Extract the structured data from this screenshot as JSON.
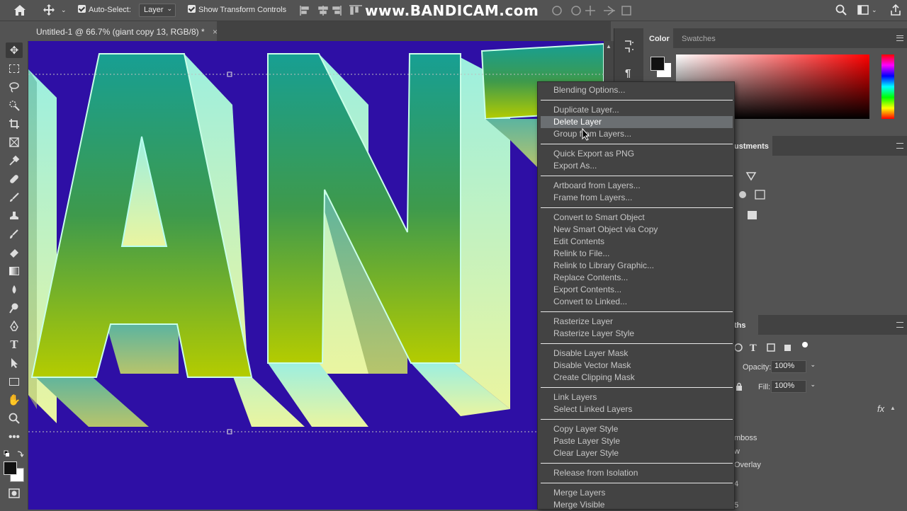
{
  "options_bar": {
    "auto_select_label": "Auto-Select:",
    "layer_select_value": "Layer",
    "show_transform_label": "Show Transform Controls"
  },
  "watermark": "www.BANDICAM.com",
  "document": {
    "tab_title": "Untitled-1 @ 66.7% (giant copy 13, RGB/8) *",
    "close_glyph": "×",
    "artwork_text": "ANT"
  },
  "panels": {
    "color_tab": "Color",
    "swatches_tab": "Swatches",
    "adjustments_tab": "ustments",
    "paths_tab": "ths",
    "opacity_label": "Opacity:",
    "opacity_value": "100%",
    "fill_label": "Fill:",
    "fill_value": "100%",
    "fx_label": "fx",
    "effect_emboss": "mboss",
    "effect_w": "w",
    "effect_overlay": "Overlay",
    "digit_4": "4",
    "digit_5": "5"
  },
  "context_menu": {
    "groups": [
      [
        "Blending Options..."
      ],
      [
        "Duplicate Layer...",
        "Delete Layer",
        "Group from Layers..."
      ],
      [
        "Quick Export as PNG",
        "Export As..."
      ],
      [
        "Artboard from Layers...",
        "Frame from Layers..."
      ],
      [
        "Convert to Smart Object",
        "New Smart Object via Copy",
        "Edit Contents",
        "Relink to File...",
        "Relink to Library Graphic...",
        "Replace Contents...",
        "Export Contents...",
        "Convert to Linked..."
      ],
      [
        "Rasterize Layer",
        "Rasterize Layer Style"
      ],
      [
        "Disable Layer Mask",
        "Disable Vector Mask",
        "Create Clipping Mask"
      ],
      [
        "Link Layers",
        "Select Linked Layers"
      ],
      [
        "Copy Layer Style",
        "Paste Layer Style",
        "Clear Layer Style"
      ],
      [
        "Release from Isolation"
      ],
      [
        "Merge Layers",
        "Merge Visible"
      ]
    ],
    "highlighted": "Delete Layer"
  },
  "colors": {
    "canvas_background": "#2e0fa5",
    "text_face_top": "#1aa08e",
    "text_face_bottom": "#a9c600",
    "menu_highlight": "#6b6f72"
  },
  "icons": {
    "home": "home-icon",
    "move": "move-icon",
    "cursor": "pointer-cursor-icon"
  }
}
